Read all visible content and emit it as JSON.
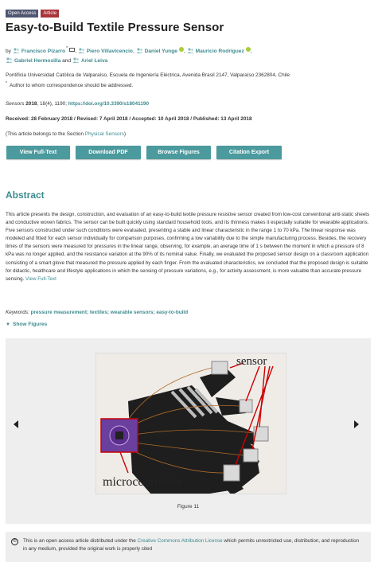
{
  "badges": {
    "open_access": "Open Access",
    "article": "Article"
  },
  "title": "Easy-to-Build Textile Pressure Sensor",
  "authors": {
    "by": "by",
    "list": [
      {
        "name": "Francisco Pizarro",
        "sup": "*",
        "mail": true,
        "orcid": false
      },
      {
        "name": "Piero Villavicencio",
        "orcid": false
      },
      {
        "name": "Daniel Yunge",
        "orcid": true
      },
      {
        "name": "Mauricio Rodríguez",
        "orcid": true
      },
      {
        "name": "Gabriel Hermosilla",
        "orcid": false
      },
      {
        "name": "Ariel Leiva",
        "orcid": false
      }
    ],
    "and": "and"
  },
  "affiliation": {
    "line1": "Pontificia Universidad Católica de Valparaíso, Escuela de Ingeniería Eléctrica, Avenida Brasil 2147, Valparaíso 2362804, Chile",
    "line2_mark": "*",
    "line2": "Author to whom correspondence should be addressed."
  },
  "citation": {
    "journal": "Sensors",
    "year": "2018",
    "volume_pages": ", 18(4), 1190;",
    "doi": "https://doi.org/10.3390/s18041190"
  },
  "dates": "Received: 28 February 2018 / Revised: 7 April 2018 / Accepted: 10 April 2018 / Published: 13 April 2018",
  "section_note": {
    "prefix": "(This article belongs to the Section ",
    "link": "Physical Sensors",
    "suffix": ")"
  },
  "buttons": {
    "view_full_text": "View Full-Text",
    "download_pdf": "Download PDF",
    "browse_figures": "Browse Figures",
    "citation_export": "Citation Export"
  },
  "abstract": {
    "heading": "Abstract",
    "text": "This article presents the design, construction, and evaluation of an easy-to-build textile pressure resistive sensor created from low-cost conventional anti-static sheets and conductive woven fabrics. The sensor can be built quickly using standard household tools, and its thinness makes it especially suitable for wearable applications. Five sensors constructed under such conditions were evaluated, presenting a stable and linear characteristic in the range 1 to 70 kPa. The linear response was modeled and fitted for each sensor individually for comparison purposes, confirming a low variability due to the simple manufacturing process. Besides, the recovery times of the sensors were measured for pressures in the linear range, observing, for example, an average time of 1 s between the moment in which a pressure of 8 kPa was no longer applied, and the resistance variation at the 90% of its nominal value. Finally, we evaluated the proposed sensor design on a classroom application consisting of a smart glove that measured the pressure applied by each finger. From the evaluated characteristics, we concluded that the proposed design is suitable for didactic, healthcare and lifestyle applications in which the sensing of pressure variations, e.g., for activity assessment, is more valuable than accurate pressure sensing.",
    "view_full_text": "View Full-Text"
  },
  "keywords": {
    "label": "Keywords:",
    "items": "pressure measurement; textiles; wearable sensors; easy-to-build"
  },
  "show_figures": "Show Figures",
  "figure": {
    "caption": "Figure 11",
    "label_sensor": "sensor",
    "label_micro": "microcontroller"
  },
  "license": {
    "cc": "©",
    "prefix": "This is an open access article distributed under the ",
    "link": "Creative Commons Attribution License",
    "suffix": " which permits unrestricted use, distribution, and reproduction in any medium, provided the original work is properly cited"
  },
  "colors": {
    "accent": "#3d8a8f",
    "button": "#4b9a9e",
    "article_badge": "#a8353a",
    "open_access_badge": "#4f5671"
  }
}
